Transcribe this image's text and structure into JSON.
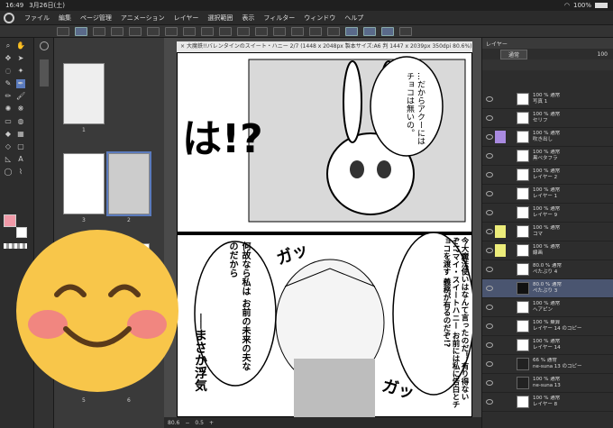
{
  "status": {
    "time": "16:49",
    "date": "3月26日(土)",
    "battery": "100%"
  },
  "menu": [
    "ファイル",
    "編集",
    "ページ管理",
    "アニメーション",
    "レイヤー",
    "選択範囲",
    "表示",
    "フィルター",
    "ウィンドウ",
    "ヘルプ"
  ],
  "doc": {
    "title": "大魔鉄!!バレンタインのスイート・ハニー 2/7 (1448 x 2048px 製本サイズ:A6 判 1447 x 2039px 350dpi 80.6%)"
  },
  "pages": [
    {
      "num": "1"
    },
    {
      "num": "3"
    },
    {
      "num": "2"
    },
    {
      "num": "5"
    },
    {
      "num": "6"
    }
  ],
  "bottom": {
    "zoom": "80.6",
    "step": "0.5"
  },
  "layers": {
    "tab": "レイヤー",
    "blend": "通常",
    "opacity": "100",
    "rows": [
      {
        "pct": "100 % 通常",
        "name": "写真 1"
      },
      {
        "pct": "100 % 通常",
        "name": "セリフ"
      },
      {
        "pct": "100 % 通常",
        "name": "吹き出し"
      },
      {
        "pct": "100 % 通常",
        "name": "黒ベタフラ"
      },
      {
        "pct": "100 % 通常",
        "name": "レイヤー 2"
      },
      {
        "pct": "100 % 通常",
        "name": "レイヤー 1"
      },
      {
        "pct": "100 % 通常",
        "name": "レイヤー 9"
      },
      {
        "pct": "100 % 通常",
        "name": "コマ"
      },
      {
        "pct": "100 % 通常",
        "name": "線画"
      },
      {
        "pct": "80.0 % 通常",
        "name": "ぺたぶり 4"
      },
      {
        "pct": "80.0 % 通常",
        "name": "ぺたぶり 3"
      },
      {
        "pct": "100 % 通常",
        "name": "ヘアピン"
      },
      {
        "pct": "100 % 乗算",
        "name": "レイヤー 14 のコピー"
      },
      {
        "pct": "100 % 通常",
        "name": "レイヤー 14"
      },
      {
        "pct": "66 % 通常",
        "name": "ne-suna 13 のコピー"
      },
      {
        "pct": "100 % 通常",
        "name": "ne-suna 13"
      },
      {
        "pct": "100 % 通常",
        "name": "レイヤー 8"
      }
    ]
  },
  "manga": {
    "bubble1": "…だからアクーには チョコは無いの。",
    "shout": "は!?",
    "sfx1": "ガッ",
    "sfx2": "ガッ",
    "dialog2": "今大魔法使いはなんて言ったのだ！ 有り得ないぞ!?マイ・スイートハニー お前には私に告白とチョコを渡す 義務が有るのだぞ!?",
    "dialog3": "何故なら私は お前の未来の夫なのだから",
    "dialog4": "──まさか浮気"
  },
  "colors": {
    "accent": "#5b7bbd",
    "purple": "#a98ae0",
    "yellow": "#ecec7a",
    "emoji": "#f8c64a"
  }
}
